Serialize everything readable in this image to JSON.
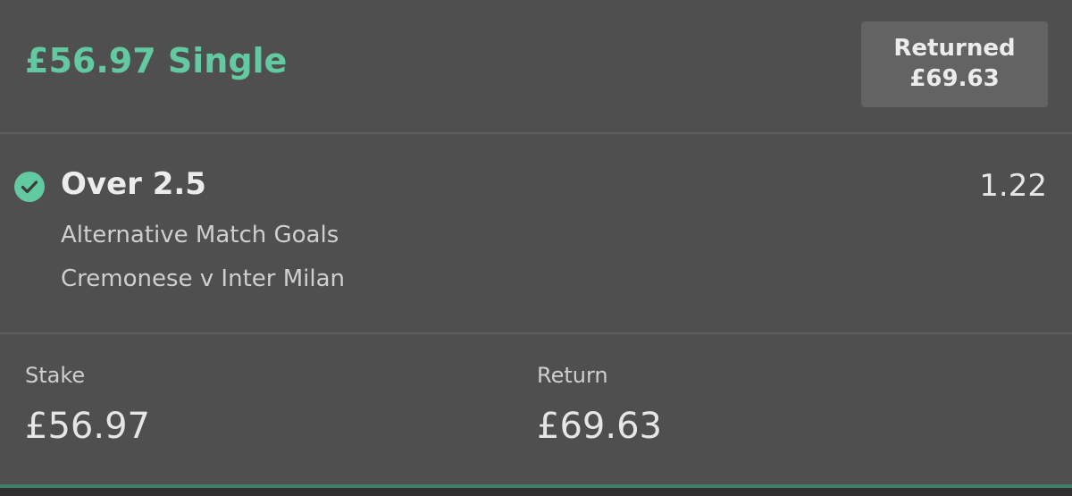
{
  "bet": {
    "title": "£56.97 Single",
    "returned_label": "Returned",
    "returned_amount": "£69.63"
  },
  "selection": {
    "status_icon": "check-circle-icon",
    "name": "Over 2.5",
    "odds": "1.22",
    "market": "Alternative Match Goals",
    "event": "Cremonese v Inter Milan"
  },
  "summary": {
    "stake_label": "Stake",
    "stake_value": "£56.97",
    "return_label": "Return",
    "return_value": "£69.63"
  },
  "colors": {
    "background": "#4f4f4f",
    "accent_green": "#62c9a0",
    "badge_background": "#636363",
    "divider": "#5d5d5d"
  }
}
